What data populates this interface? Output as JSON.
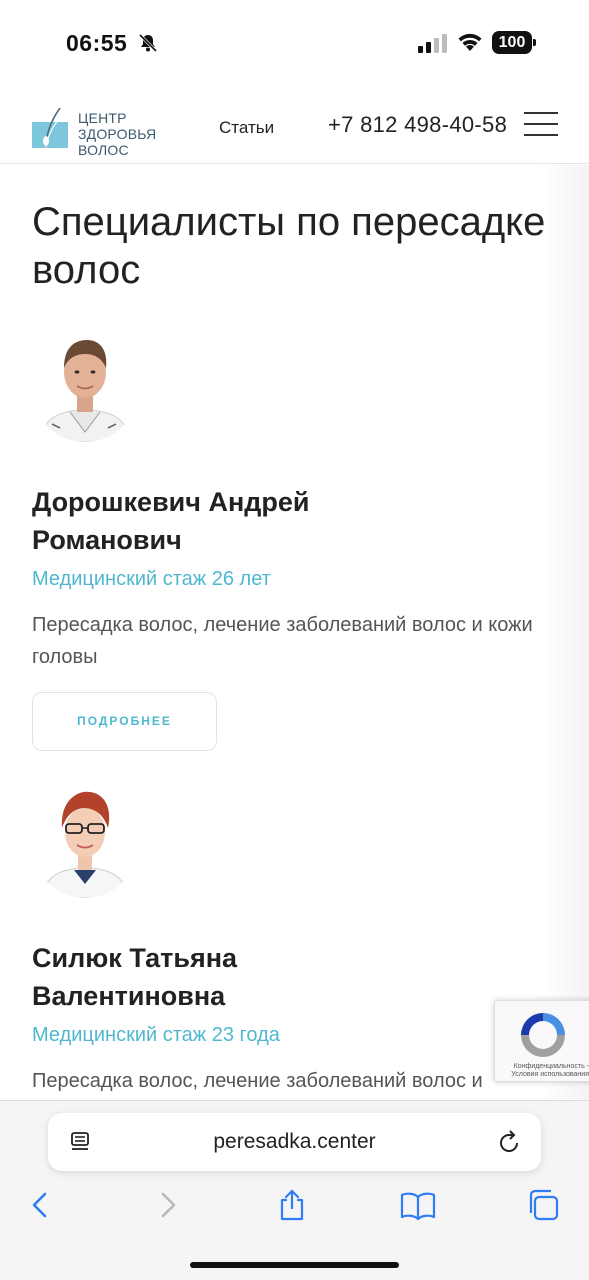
{
  "status_bar": {
    "time": "06:55",
    "battery": "100"
  },
  "header": {
    "logo_text": "ЦЕНТР ЗДОРОВЬЯ ВОЛОС",
    "nav_articles": "Статьи",
    "phone": "+7 812 498-40-58"
  },
  "main": {
    "title": "Специалисты по пересадке волос",
    "doctors": [
      {
        "name": "Дорошкевич Андрей Романович",
        "experience": "Медицинский стаж 26 лет",
        "description": "Пересадка волос, лечение заболеваний волос и кожи головы",
        "button": "ПОДРОБНЕЕ"
      },
      {
        "name": "Силюк Татьяна Валентиновна",
        "experience": "Медицинский стаж 23 года",
        "description": "Пересадка волос, лечение заболеваний волос и"
      }
    ]
  },
  "recaptcha": {
    "text": "Конфиденциальность - Условия использования"
  },
  "browser": {
    "url": "peresadka.center"
  },
  "colors": {
    "accent": "#4fb8cf",
    "text": "#222222"
  }
}
